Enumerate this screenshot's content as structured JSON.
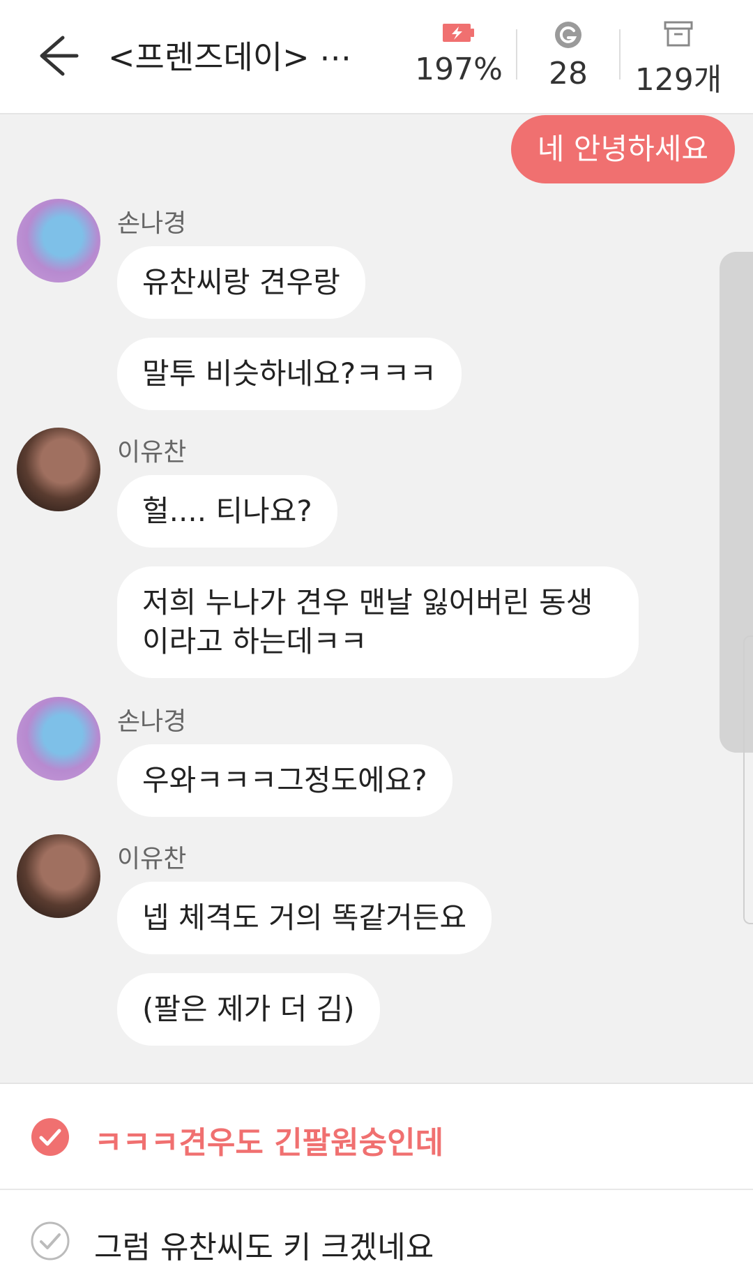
{
  "header": {
    "title": "<프렌즈데이> ⋯",
    "battery": "197%",
    "g_count": "28",
    "box_count": "129개"
  },
  "chat": {
    "my_message": "네 안녕하세요",
    "messages": [
      {
        "sender": "손나경",
        "bubbles": [
          "유찬씨랑 견우랑",
          "말투 비슷하네요?ㅋㅋㅋ"
        ]
      },
      {
        "sender": "이유찬",
        "bubbles": [
          "헐.... 티나요?",
          "저희 누나가 견우 맨날 잃어버린 동생이라고 하는데ㅋㅋ"
        ]
      },
      {
        "sender": "손나경",
        "bubbles": [
          "우와ㅋㅋㅋ그정도에요?"
        ]
      },
      {
        "sender": "이유찬",
        "bubbles": [
          "넵 체격도 거의 똑같거든요",
          "(팔은 제가 더 김)"
        ]
      }
    ]
  },
  "suggestions": [
    {
      "text": "ㅋㅋㅋ견우도 긴팔원숭인데",
      "selected": true
    },
    {
      "text": "그럼 유찬씨도 키 크겠네요",
      "selected": false
    }
  ],
  "colors": {
    "accent": "#f07070",
    "background": "#f1f1f1"
  },
  "icons": {
    "back": "arrow-left-icon",
    "battery": "battery-bolt-icon",
    "g": "g-coin-icon",
    "box": "archive-box-icon",
    "check": "check-circle-icon"
  }
}
